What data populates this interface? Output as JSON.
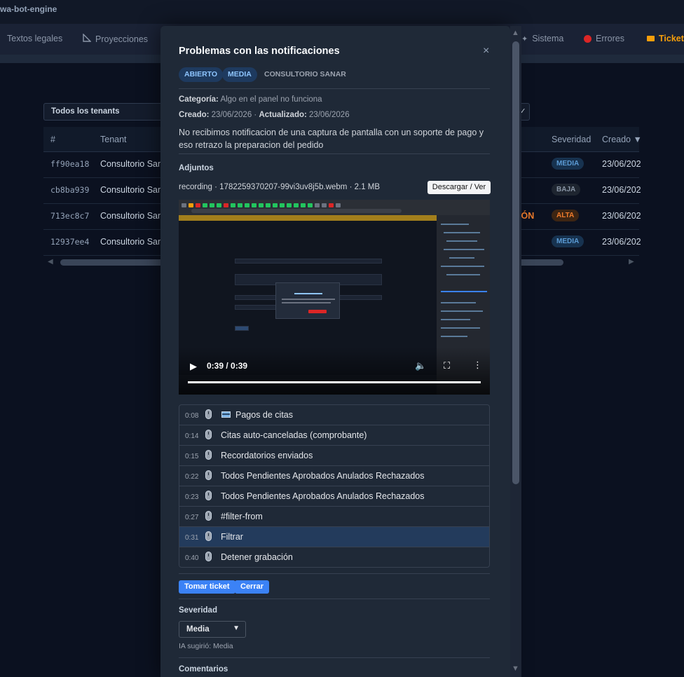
{
  "app": {
    "title": "wa-bot-engine"
  },
  "nav": [
    {
      "label": "Textos legales",
      "icon": ""
    },
    {
      "label": "Proyecciones",
      "icon": "ruler-icon"
    },
    {
      "label": "Sistema",
      "icon": "gear-icon"
    },
    {
      "label": "Errores",
      "icon": "error-dot-icon"
    },
    {
      "label": "Tickets",
      "icon": "ticket-icon"
    }
  ],
  "filter": {
    "tenant_label": "Todos los tenants",
    "check": "✓"
  },
  "table": {
    "headers": {
      "id": "#",
      "tenant": "Tenant",
      "severity": "Severidad",
      "created": "Creado ▼"
    },
    "rows": [
      {
        "id": "ff90ea18",
        "tenant": "Consultorio Sanar",
        "state": "",
        "severity": "MEDIA",
        "created": "23/06/202"
      },
      {
        "id": "cb8ba939",
        "tenant": "Consultorio Sanar",
        "state": "",
        "severity": "BAJA",
        "created": "23/06/202"
      },
      {
        "id": "713ec8c7",
        "tenant": "Consultorio Sanar",
        "state": "IÓN",
        "severity": "ALTA",
        "created": "23/06/202"
      },
      {
        "id": "12937ee4",
        "tenant": "Consultorio Sanar",
        "state": "",
        "severity": "MEDIA",
        "created": "23/06/202"
      }
    ]
  },
  "modal": {
    "title": "Problemas con las notificaciones",
    "close": "×",
    "badges": {
      "status": "ABIERTO",
      "severity": "MEDIA",
      "tenant": "CONSULTORIO SANAR"
    },
    "category_label": "Categoría:",
    "category_value": "Algo en el panel no funciona",
    "created_label": "Creado:",
    "created_value": "23/06/2026",
    "updated_label": "Actualizado:",
    "updated_value": "23/06/2026",
    "description": "No recibimos notificacion de una captura de pantalla con un soporte de pago y eso retrazo la preparacion del pedido",
    "attachments_label": "Adjuntos",
    "file_line": "recording · 1782259370207-99vi3uv8j5b.webm · 2.1 MB",
    "download_label": "Descargar / Ver",
    "video": {
      "time": "0:39 / 0:39",
      "progress": 1.0
    },
    "events": [
      {
        "time": "0:08",
        "label": "Pagos de citas",
        "emoji": "credit-card-icon",
        "highlight": false
      },
      {
        "time": "0:14",
        "label": "Citas auto-canceladas (comprobante)",
        "emoji": "",
        "highlight": false
      },
      {
        "time": "0:15",
        "label": "Recordatorios enviados",
        "emoji": "",
        "highlight": false
      },
      {
        "time": "0:22",
        "label": "Todos Pendientes Aprobados Anulados Rechazados",
        "emoji": "",
        "highlight": false
      },
      {
        "time": "0:23",
        "label": "Todos Pendientes Aprobados Anulados Rechazados",
        "emoji": "",
        "highlight": false
      },
      {
        "time": "0:27",
        "label": "#filter-from",
        "emoji": "",
        "highlight": false
      },
      {
        "time": "0:31",
        "label": "Filtrar",
        "emoji": "",
        "highlight": true
      },
      {
        "time": "0:40",
        "label": "Detener grabación",
        "emoji": "",
        "highlight": false
      }
    ],
    "take_ticket_label": "Tomar ticket",
    "close_ticket_label": "Cerrar",
    "severity_label": "Severidad",
    "severity_value": "Media",
    "ai_hint": "IA sugirió: Media",
    "comments_label": "Comentarios"
  },
  "colors": {
    "accent": "#3b82f6",
    "highlight_row": "#233b5c",
    "modal_bg": "#1f2937",
    "page_bg": "#0b1120"
  }
}
